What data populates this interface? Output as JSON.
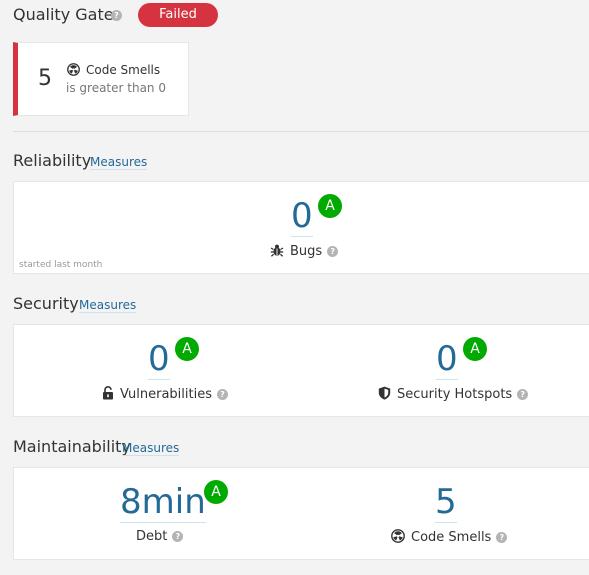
{
  "quality_gate": {
    "title": "Quality Gate",
    "help_icon": "question-circle-icon",
    "status": "Failed",
    "status_color": "#d4333f"
  },
  "condition": {
    "value": "5",
    "metric": "Code Smells",
    "metric_icon": "code-smell-icon",
    "operator_text": "is greater than 0"
  },
  "reliability": {
    "title": "Reliability",
    "measures_link": "Measures",
    "bugs": {
      "value": "0",
      "rating": "A",
      "label": "Bugs",
      "icon": "bug-icon"
    },
    "note": "started last month"
  },
  "security": {
    "title": "Security",
    "measures_link": "Measures",
    "vulnerabilities": {
      "value": "0",
      "rating": "A",
      "label": "Vulnerabilities",
      "icon": "unlock-icon"
    },
    "hotspots": {
      "value": "0",
      "rating": "A",
      "label": "Security Hotspots",
      "icon": "shield-icon"
    }
  },
  "maintainability": {
    "title": "Maintainability",
    "measures_link": "Measures",
    "debt": {
      "value": "8min",
      "rating": "A",
      "label": "Debt"
    },
    "code_smells": {
      "value": "5",
      "label": "Code Smells",
      "icon": "code-smell-icon"
    }
  },
  "colors": {
    "rating_a": "#00aa00",
    "link": "#236a97",
    "failed": "#d4333f"
  }
}
